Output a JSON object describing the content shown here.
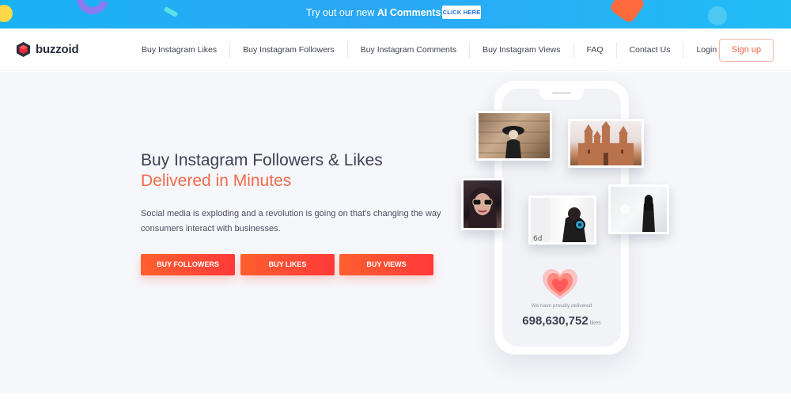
{
  "promo": {
    "text_prefix": "Try out our new ",
    "text_bold": "AI Comments",
    "text_suffix": "!",
    "button_label": "CLICK HERE"
  },
  "brand": {
    "name": "buzzoid",
    "accent": "#e8283c"
  },
  "nav": {
    "links": [
      "Buy Instagram Likes",
      "Buy Instagram Followers",
      "Buy Instagram Comments",
      "Buy Instagram Views",
      "FAQ",
      "Contact Us",
      "Login"
    ],
    "signup_label": "Sign up"
  },
  "hero": {
    "title": "Buy Instagram Followers & Likes",
    "subtitle": "Delivered in Minutes",
    "description": "Social media is exploding and a revolution is going on that’s changing the way consumers interact with businesses.",
    "buttons": [
      "BUY FOLLOWERS",
      "BUY LIKES",
      "BUY VIEWS"
    ]
  },
  "stats": {
    "label": "We have proudly delivered",
    "count": "698,630,752",
    "unit": "likes"
  },
  "colors": {
    "banner": "#1fb2f5",
    "accent_orange": "#ef6a48",
    "cta_gradient_start": "#ff5f2e",
    "cta_gradient_end": "#ff3a3a",
    "heart": "#ff6f6f"
  }
}
